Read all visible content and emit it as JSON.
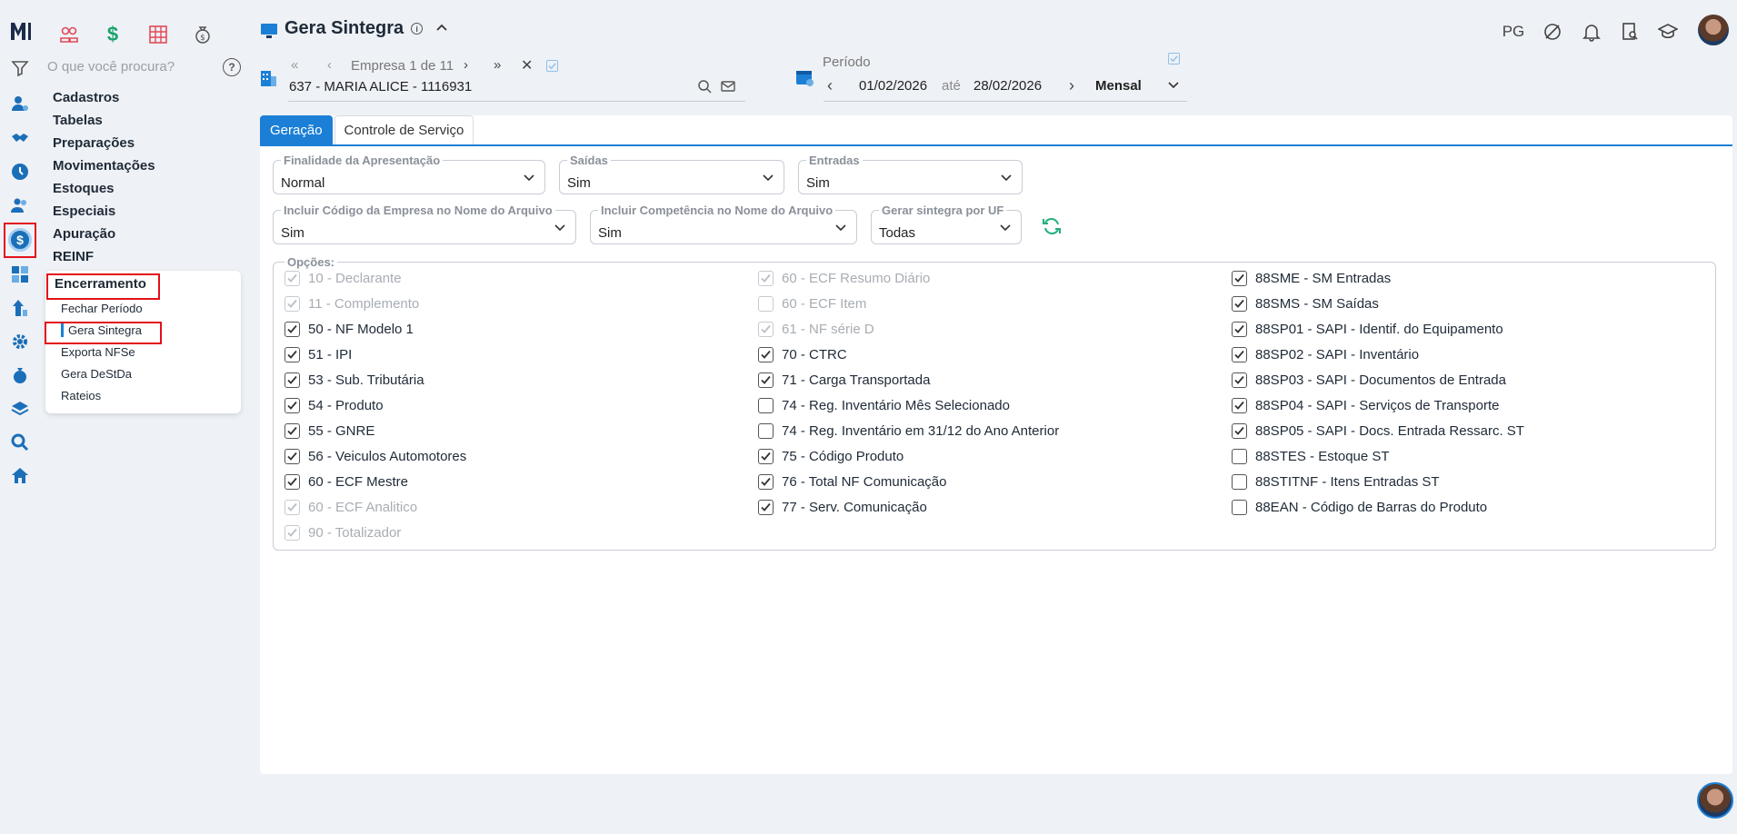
{
  "app": {
    "title": "Gera Sintegra",
    "user_initials": "PG"
  },
  "sidebar": {
    "search_placeholder": "O que você procura?",
    "help_icon": "?",
    "menu": [
      "Cadastros",
      "Tabelas",
      "Preparações",
      "Movimentações",
      "Estoques",
      "Especiais",
      "Apuração",
      "REINF"
    ],
    "submenu_title": "Encerramento",
    "submenu_items": [
      "Fechar Período",
      "Gera Sintegra",
      "Exporta NFSe",
      "Gera DeStDa",
      "Rateios"
    ]
  },
  "empresa": {
    "nav_label": "Empresa 1 de 11",
    "value": "637 - MARIA ALICE - 1116931"
  },
  "periodo": {
    "label": "Período",
    "start": "01/02/2026",
    "ate": "até",
    "end": "28/02/2026",
    "mode": "Mensal"
  },
  "tabs": [
    "Geração",
    "Controle de Serviço"
  ],
  "fields": {
    "finalidade": {
      "label": "Finalidade da Apresentação",
      "value": "Normal"
    },
    "saidas": {
      "label": "Saídas",
      "value": "Sim"
    },
    "entradas": {
      "label": "Entradas",
      "value": "Sim"
    },
    "incluir_codigo": {
      "label": "Incluir Código da Empresa no Nome do Arquivo",
      "value": "Sim"
    },
    "incluir_competencia": {
      "label": "Incluir Competência no Nome do Arquivo",
      "value": "Sim"
    },
    "gerar_uf": {
      "label": "Gerar sintegra por UF",
      "value": "Todas"
    }
  },
  "options_label": "Opções:",
  "options": {
    "col1": [
      {
        "label": "10 - Declarante",
        "checked": true,
        "disabled": true
      },
      {
        "label": "11 - Complemento",
        "checked": true,
        "disabled": true
      },
      {
        "label": "50 - NF Modelo 1",
        "checked": true,
        "disabled": false
      },
      {
        "label": "51 - IPI",
        "checked": true,
        "disabled": false
      },
      {
        "label": "53 - Sub. Tributária",
        "checked": true,
        "disabled": false
      },
      {
        "label": "54 - Produto",
        "checked": true,
        "disabled": false
      },
      {
        "label": "55 - GNRE",
        "checked": true,
        "disabled": false
      },
      {
        "label": "56 - Veiculos Automotores",
        "checked": true,
        "disabled": false
      },
      {
        "label": "60 - ECF Mestre",
        "checked": true,
        "disabled": false
      },
      {
        "label": "60 - ECF Analitico",
        "checked": true,
        "disabled": true
      },
      {
        "label": "90 - Totalizador",
        "checked": true,
        "disabled": true
      }
    ],
    "col2": [
      {
        "label": "60 - ECF Resumo Diário",
        "checked": true,
        "disabled": true
      },
      {
        "label": "60 - ECF Item",
        "checked": false,
        "disabled": true
      },
      {
        "label": "61 - NF série D",
        "checked": true,
        "disabled": true
      },
      {
        "label": "70 - CTRC",
        "checked": true,
        "disabled": false
      },
      {
        "label": "71 - Carga Transportada",
        "checked": true,
        "disabled": false
      },
      {
        "label": "74 - Reg. Inventário Mês Selecionado",
        "checked": false,
        "disabled": false
      },
      {
        "label": "74 - Reg. Inventário em 31/12 do Ano Anterior",
        "checked": false,
        "disabled": false
      },
      {
        "label": "75 - Código Produto",
        "checked": true,
        "disabled": false
      },
      {
        "label": "76 - Total NF Comunicação",
        "checked": true,
        "disabled": false
      },
      {
        "label": "77 - Serv. Comunicação",
        "checked": true,
        "disabled": false
      }
    ],
    "col3": [
      {
        "label": "88SME - SM Entradas",
        "checked": true,
        "disabled": false
      },
      {
        "label": "88SMS - SM Saídas",
        "checked": true,
        "disabled": false
      },
      {
        "label": "88SP01 - SAPI - Identif. do Equipamento",
        "checked": true,
        "disabled": false
      },
      {
        "label": "88SP02 - SAPI - Inventário",
        "checked": true,
        "disabled": false
      },
      {
        "label": "88SP03 - SAPI - Documentos de Entrada",
        "checked": true,
        "disabled": false
      },
      {
        "label": "88SP04 - SAPI - Serviços de Transporte",
        "checked": true,
        "disabled": false
      },
      {
        "label": "88SP05 - SAPI - Docs. Entrada Ressarc. ST",
        "checked": true,
        "disabled": false
      },
      {
        "label": "88STES - Estoque ST",
        "checked": false,
        "disabled": false
      },
      {
        "label": "88STITNF - Itens Entradas ST",
        "checked": false,
        "disabled": false
      },
      {
        "label": "88EAN - Código de Barras do Produto",
        "checked": false,
        "disabled": false
      }
    ]
  },
  "colors": {
    "accent": "#1b7fd6",
    "highlight": "#e3101a",
    "refresh": "#21b07a"
  }
}
